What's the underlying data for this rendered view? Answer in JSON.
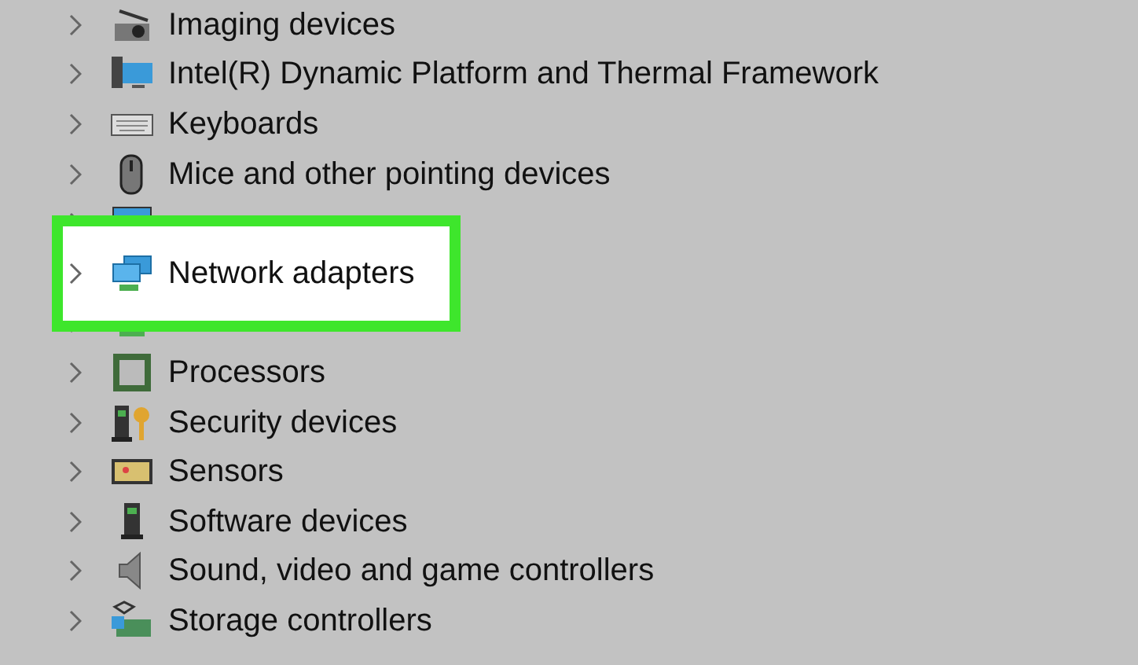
{
  "tree": {
    "items": [
      {
        "label": "Imaging devices",
        "kind": "camera",
        "selected": false
      },
      {
        "label": "Intel(R) Dynamic Platform and Thermal Framework",
        "kind": "computer",
        "selected": false
      },
      {
        "label": "Keyboards",
        "kind": "keyboard",
        "selected": false
      },
      {
        "label": "Mice and other pointing devices",
        "kind": "mouse",
        "selected": false
      },
      {
        "kind": "monitor",
        "selected": false
      },
      {
        "label": "Network adapters",
        "kind": "network",
        "selected": true
      },
      {
        "kind": "printer",
        "selected": false
      },
      {
        "label": "Processors",
        "kind": "chip",
        "selected": false
      },
      {
        "label": "Security devices",
        "kind": "security",
        "selected": false
      },
      {
        "label": "Sensors",
        "kind": "sensor",
        "selected": false
      },
      {
        "label": "Software devices",
        "kind": "software",
        "selected": false
      },
      {
        "label": "Sound, video and game controllers",
        "kind": "speaker",
        "selected": false
      },
      {
        "label": "Storage controllers",
        "kind": "storage",
        "selected": false
      }
    ]
  }
}
